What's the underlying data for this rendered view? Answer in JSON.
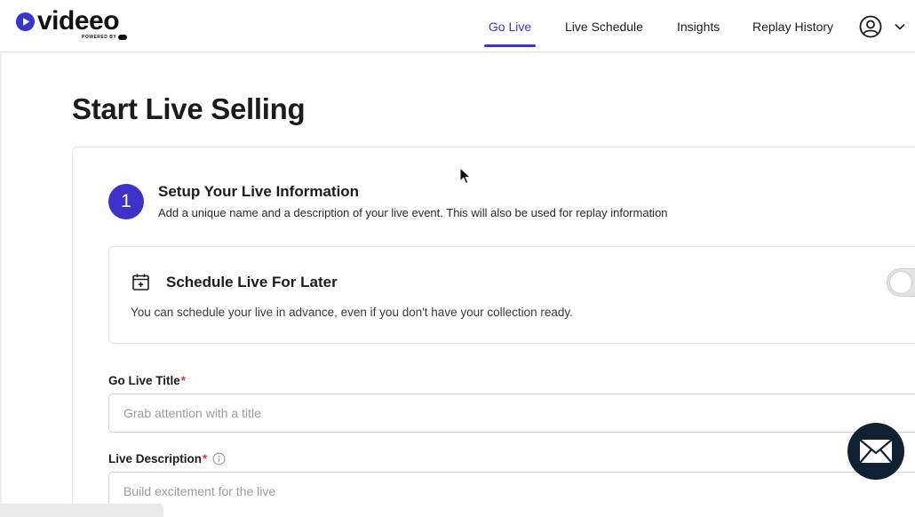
{
  "brand": {
    "name": "videeo",
    "powered_by": "POWERED BY",
    "accent": "#3a35c9"
  },
  "nav": {
    "go_live": "Go Live",
    "live_schedule": "Live Schedule",
    "insights": "Insights",
    "replay_history": "Replay History",
    "active": "Go Live",
    "account_icon": "user-circle-icon",
    "menu_icon": "chevron-down-icon"
  },
  "page": {
    "title": "Start Live Selling"
  },
  "step": {
    "number": "1",
    "title": "Setup Your Live Information",
    "description": "Add a unique name and a description of your live event. This will also be used for replay information"
  },
  "schedule": {
    "icon": "calendar-plus-icon",
    "title": "Schedule Live For Later",
    "description": "You can schedule your live in advance, even if you don't have your collection ready.",
    "toggle_on": false
  },
  "form": {
    "title_label": "Go Live Title",
    "title_required": "*",
    "title_placeholder": "Grab attention with a title",
    "title_value": "",
    "desc_label": "Live Description",
    "desc_required": "*",
    "desc_placeholder": "Build excitement for the live",
    "desc_value": ""
  },
  "fab": {
    "icon": "mail-icon",
    "color": "#0f2132"
  }
}
